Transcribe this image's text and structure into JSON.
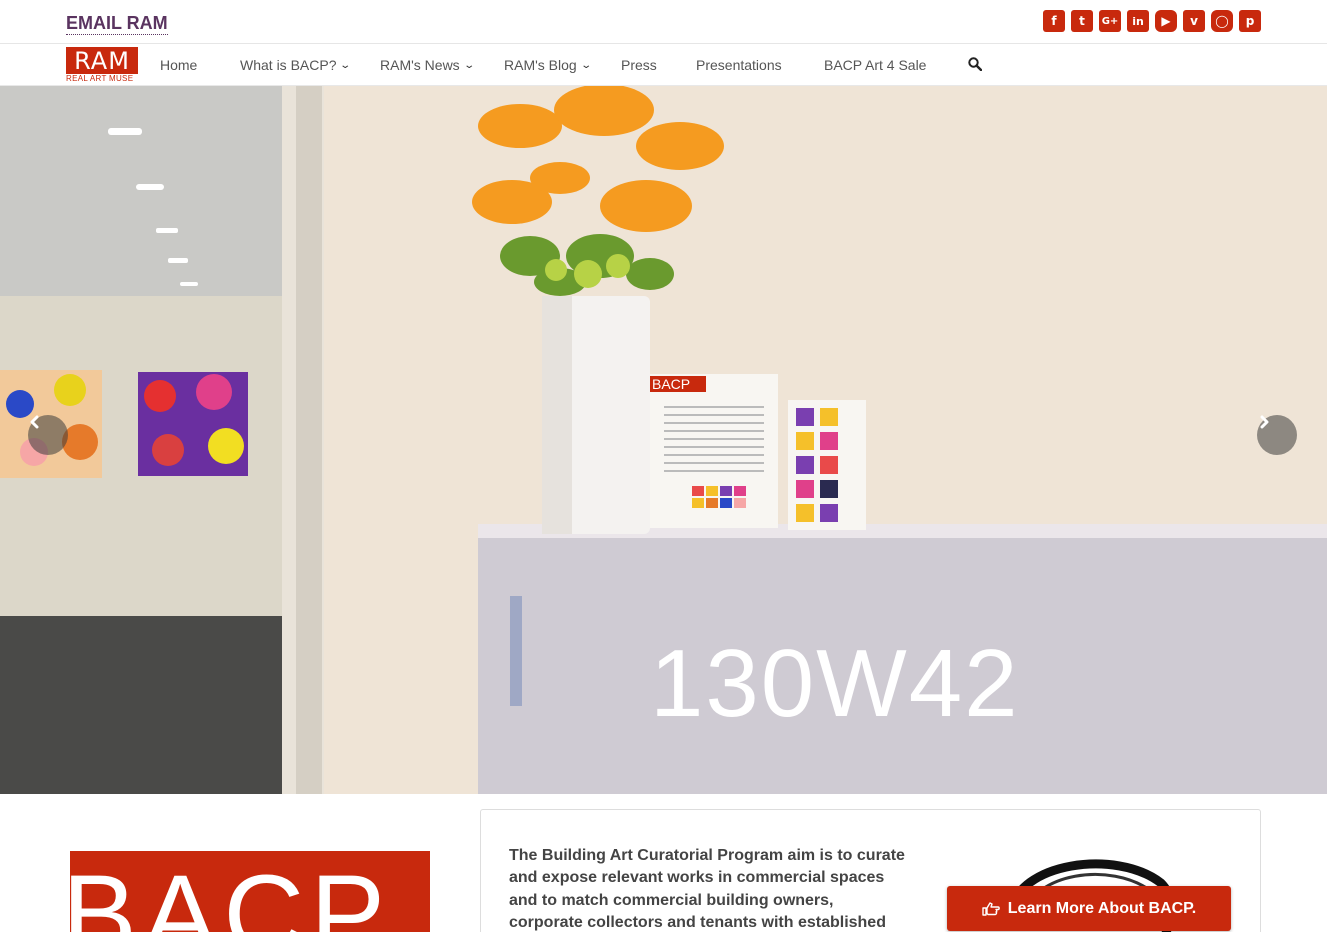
{
  "topbar": {
    "email_label": "EMAIL RAM",
    "social_icons": [
      "facebook-icon",
      "twitter-icon",
      "google-plus-icon",
      "linkedin-icon",
      "youtube-icon",
      "vimeo-icon",
      "instagram-icon",
      "pinterest-icon"
    ]
  },
  "logo": {
    "text": "RAM",
    "subtitle": "REAL ART MUSE"
  },
  "nav": {
    "items": [
      {
        "label": "Home",
        "dropdown": false
      },
      {
        "label": "What is BACP?",
        "dropdown": true
      },
      {
        "label": "RAM's News",
        "dropdown": true
      },
      {
        "label": "RAM's Blog",
        "dropdown": true
      },
      {
        "label": "Press",
        "dropdown": false
      },
      {
        "label": "Presentations",
        "dropdown": false
      },
      {
        "label": "BACP Art 4 Sale",
        "dropdown": false
      }
    ]
  },
  "hero": {
    "building_sign": "130W42",
    "card_label": "BACP"
  },
  "intro": {
    "bacp_logo_text": "BACP",
    "text": "The Building Art Curatorial Program aim is to curate and expose relevant works in commercial spaces and to match commercial building owners, corporate collectors and tenants with established",
    "button_label": "Learn More About BACP."
  },
  "colors": {
    "brand": "#c8290d",
    "email": "#5a3460"
  }
}
